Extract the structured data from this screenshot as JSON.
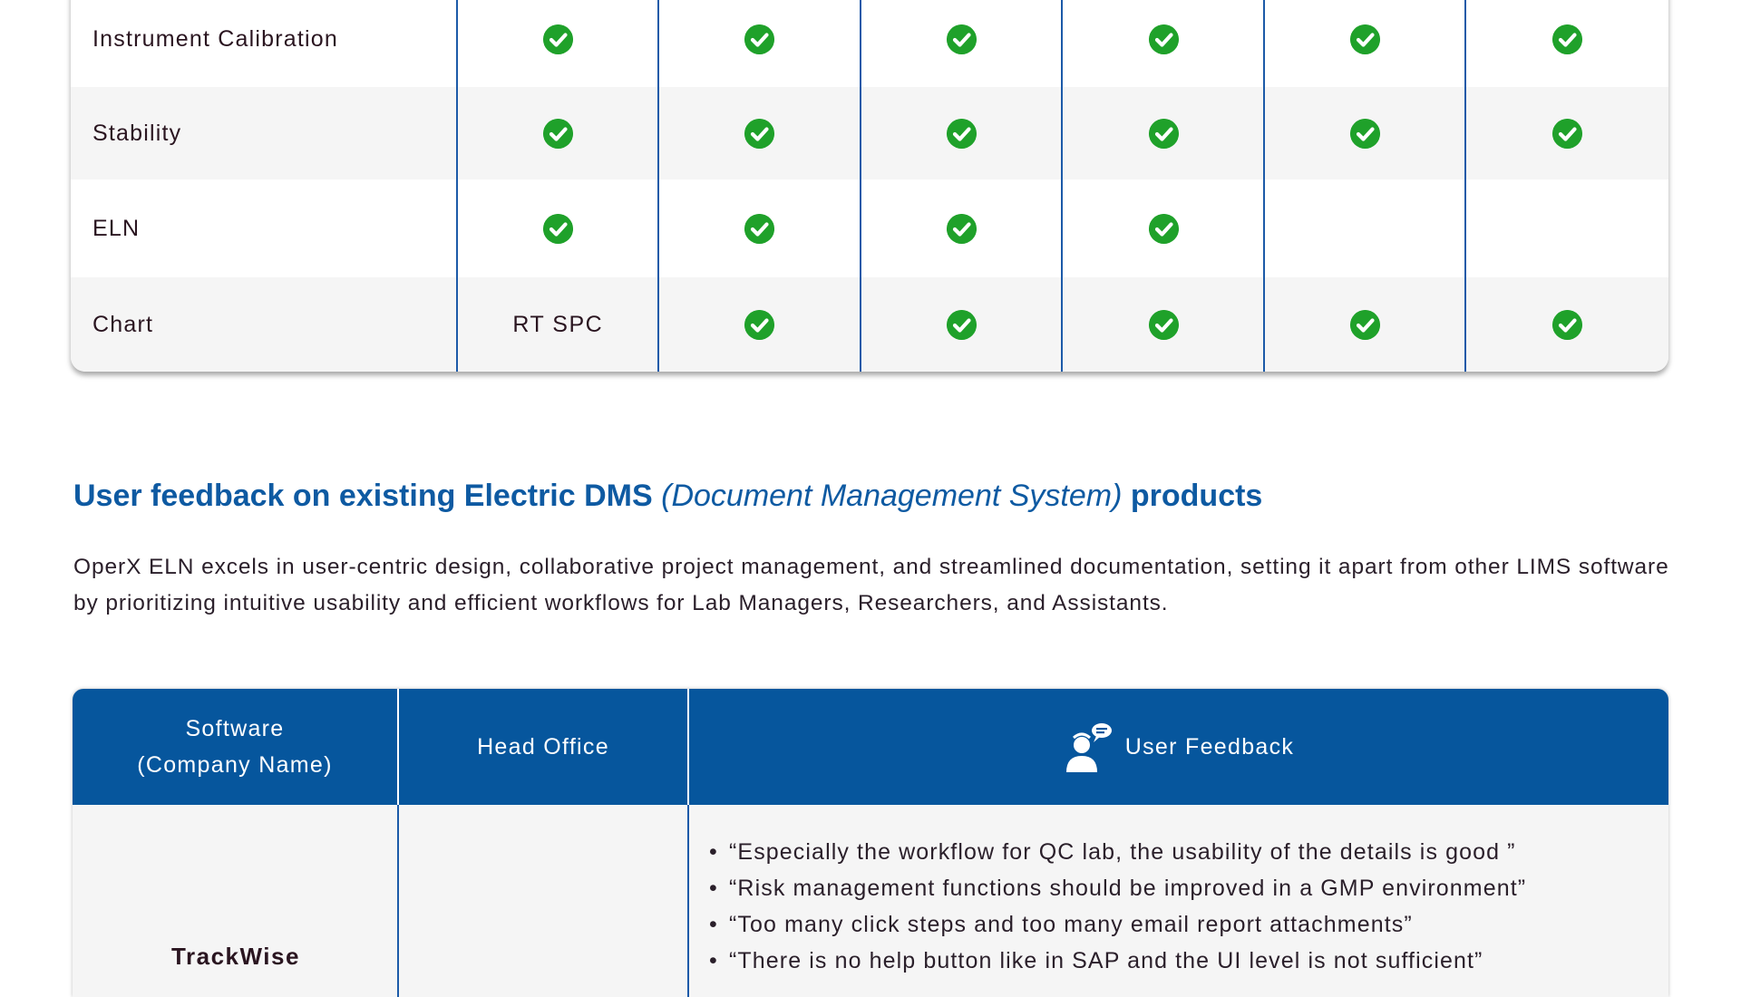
{
  "comparison_table": {
    "rows": [
      {
        "label": "Instrument Calibration",
        "cells": [
          "check",
          "check",
          "check",
          "check",
          "check",
          "check"
        ]
      },
      {
        "label": "Stability",
        "cells": [
          "check",
          "check",
          "check",
          "check",
          "check",
          "check"
        ]
      },
      {
        "label": "ELN",
        "cells": [
          "check",
          "check",
          "check",
          "check",
          "",
          ""
        ]
      },
      {
        "label": "Chart",
        "cells": [
          "RT SPC",
          "check",
          "check",
          "check",
          "check",
          "check"
        ]
      }
    ],
    "check_icon": "check-circle-icon",
    "check_color": "#1fa12a",
    "divider_color": "#1c5aa8"
  },
  "section": {
    "title_bold_1": "User feedback on existing Electric DMS",
    "title_italic": "(Document Management System)",
    "title_bold_2": "products",
    "description": "OperX ELN excels in user-centric design, collaborative project management, and streamlined documentation, setting it apart from other LIMS software by prioritizing intuitive usability and efficient workflows for Lab Managers, Researchers, and Assistants.",
    "title_color": "#0e5aa2"
  },
  "feedback_table": {
    "header_color": "#06569d",
    "headers": {
      "software_line1": "Software",
      "software_line2": "(Company Name)",
      "head_office": "Head Office",
      "user_feedback": "User Feedback",
      "user_feedback_icon": "user-speech-icon"
    },
    "rows": [
      {
        "company": "TrackWise",
        "head_office": "",
        "feedback": [
          "“Especially the workflow for QC lab, the usability of the details is good ”",
          "“Risk management functions should be improved in a GMP environment”",
          "“Too many click steps and too many email report attachments”",
          "“There is no help button like in SAP and the UI level is not sufficient”"
        ]
      }
    ]
  }
}
